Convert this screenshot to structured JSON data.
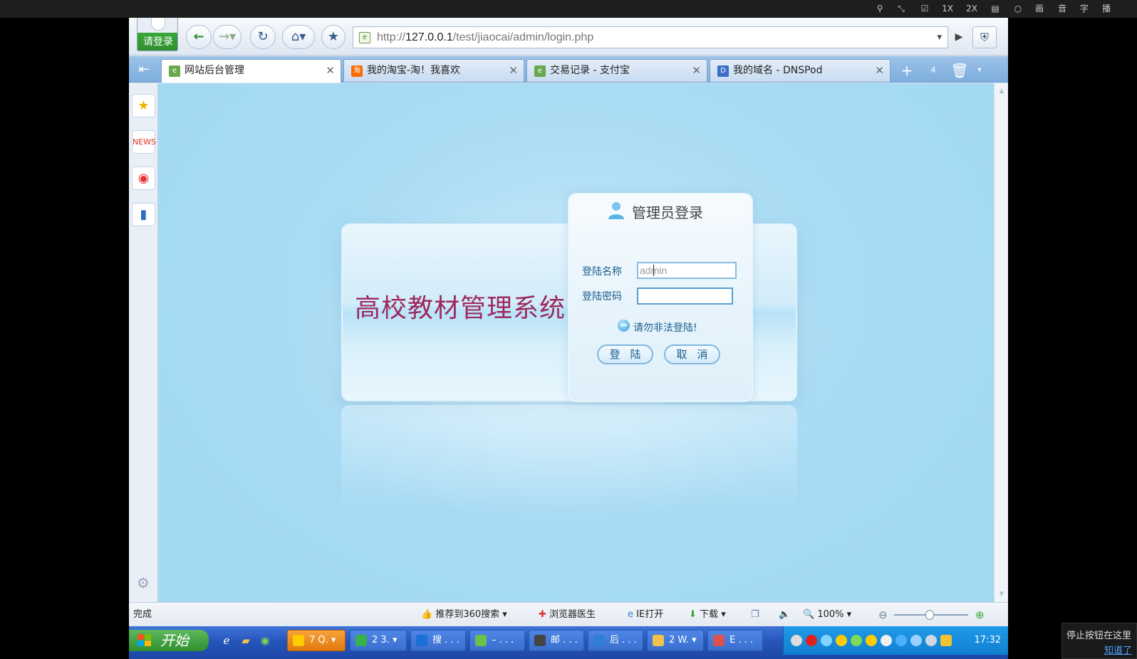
{
  "player": {
    "controls": [
      "1X",
      "2X",
      "画",
      "音",
      "字",
      "播"
    ]
  },
  "browser": {
    "login_badge": "请登录",
    "address": {
      "url_prefix": "http://",
      "url_host": "127.0.0.1",
      "url_path": "/test/jiaocai/admin/login.php"
    },
    "tabs": [
      {
        "label": "网站后台管理",
        "icon_color": "#6aa84f",
        "active": true
      },
      {
        "label": "我的淘宝-淘！我喜欢",
        "icon_color": "#ff6a00",
        "active": false
      },
      {
        "label": "交易记录 - 支付宝",
        "icon_color": "#6aa84f",
        "active": false
      },
      {
        "label": "我的域名 - DNSPod",
        "icon_color": "#3d6fc8",
        "active": false
      }
    ],
    "tab_count_badge": "4"
  },
  "login": {
    "system_title": "高校教材管理系统",
    "panel_title": "管理员登录",
    "username_label": "登陆名称",
    "username_value": "admin",
    "password_label": "登陆密码",
    "password_value": "",
    "warning": "请勿非法登陆!",
    "login_button": "登陆",
    "cancel_button": "取消"
  },
  "status": {
    "done": "完成",
    "recommend": "推荐到360搜索",
    "doctor": "浏览器医生",
    "ie_open": "IE打开",
    "download": "下载",
    "zoom": "100%"
  },
  "taskbar": {
    "start": "开始",
    "buttons": [
      {
        "label": "7 Q.",
        "highlight": true,
        "icon_color": "#ffcc00"
      },
      {
        "label": "2 3.",
        "highlight": false,
        "icon_color": "#35b34a"
      },
      {
        "label": "搜 . . .",
        "highlight": false,
        "icon_color": "#1c6fd6"
      },
      {
        "label": "– . . .",
        "highlight": false,
        "icon_color": "#6cc04a"
      },
      {
        "label": "邮 . . .",
        "highlight": false,
        "icon_color": "#444444"
      },
      {
        "label": "后 . . .",
        "highlight": false,
        "icon_color": "#2f7fd8"
      },
      {
        "label": "2 W.",
        "highlight": false,
        "icon_color": "#f3c24b"
      },
      {
        "label": "E . . .",
        "highlight": false,
        "icon_color": "#d9534f"
      }
    ],
    "clock": "17:32"
  },
  "hint": {
    "line1": "停止按钮在这里",
    "line2": "知道了"
  }
}
